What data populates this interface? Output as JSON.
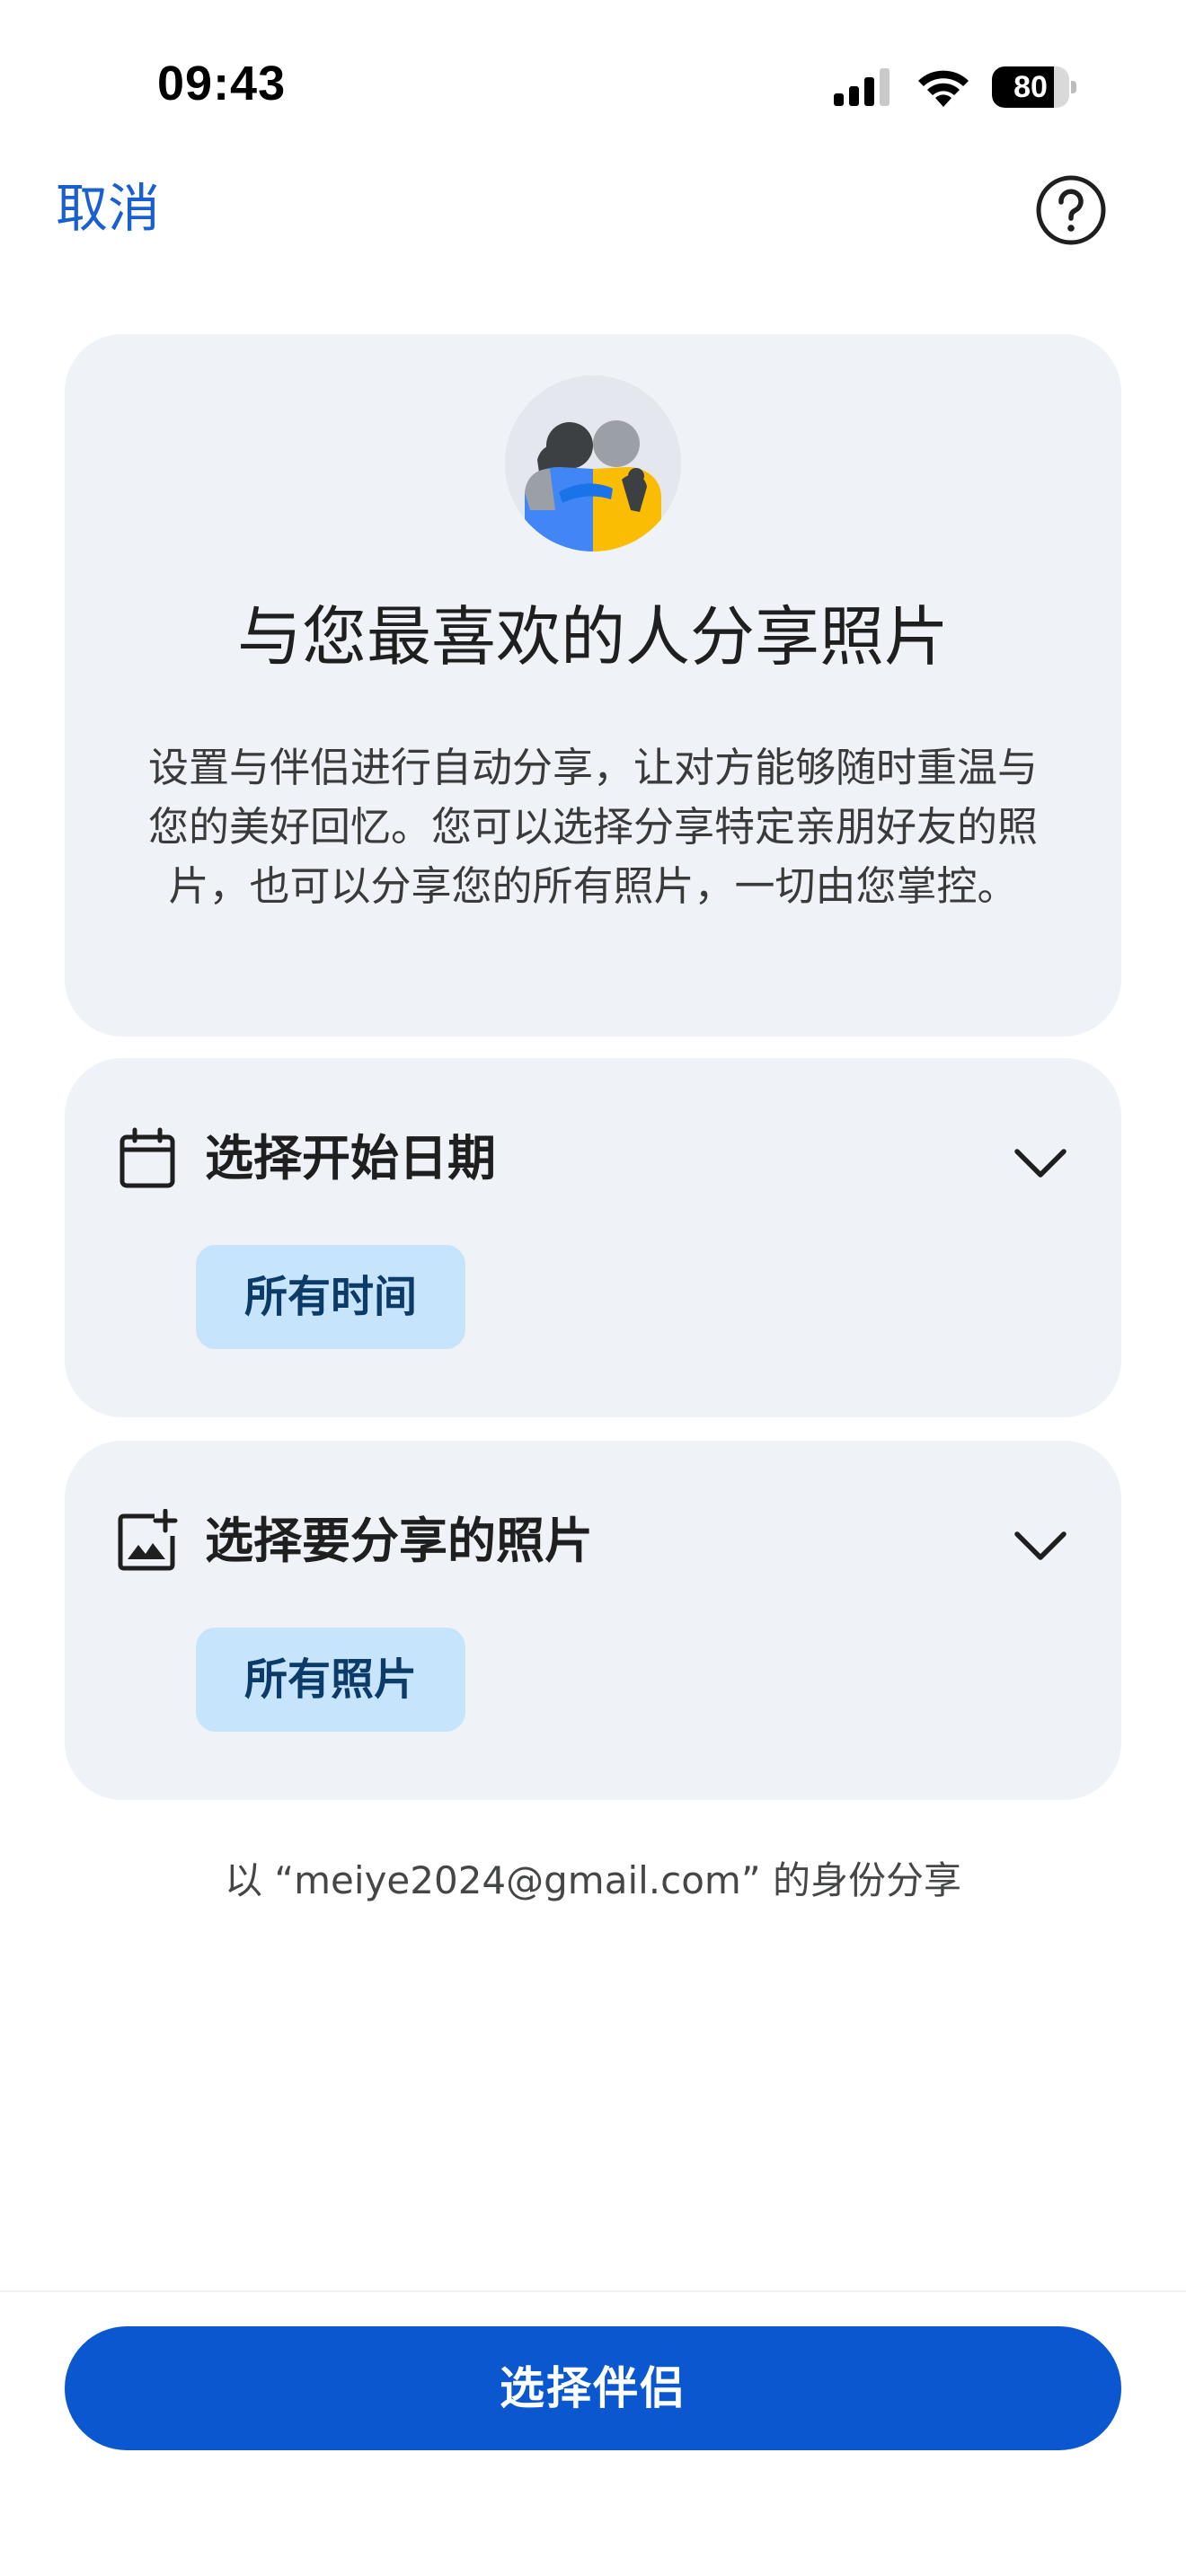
{
  "status_bar": {
    "time": "09:43",
    "battery_level": "80",
    "battery_fraction": 0.8
  },
  "header": {
    "cancel_label": "取消",
    "help_icon": "help-circle-icon"
  },
  "hero": {
    "illustration": "two-people-illustration",
    "title": "与您最喜欢的人分享照片",
    "description": "设置与伴侣进行自动分享，让对方能够随时重温与您的美好回忆。您可以选择分享特定亲朋好友的照片，也可以分享您的所有照片，一切由您掌控。"
  },
  "options": {
    "start_date": {
      "icon": "calendar-icon",
      "title": "选择开始日期",
      "chip": "所有时间"
    },
    "photos": {
      "icon": "add-photo-icon",
      "title": "选择要分享的照片",
      "chip": "所有照片"
    }
  },
  "share_as_text": "以 “meiye2024@gmail.com” 的身份分享",
  "bottom": {
    "primary_button_label": "选择伴侣"
  },
  "colors": {
    "accent": "#0b57d0",
    "link": "#1a5fd0",
    "card_bg": "#eff2f7",
    "chip_bg": "#c6e4fb",
    "chip_text": "#0b3b66"
  }
}
